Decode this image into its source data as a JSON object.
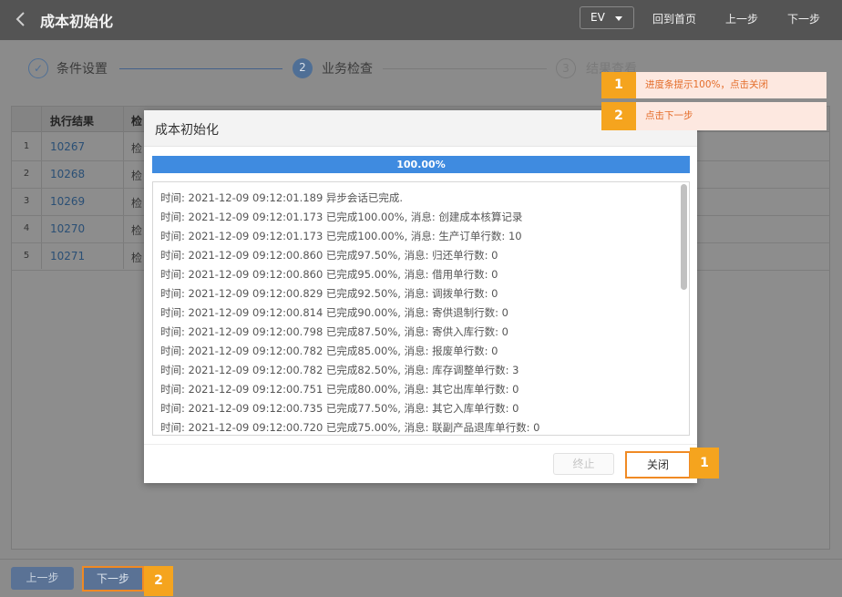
{
  "header": {
    "title": "成本初始化",
    "org_select": "EV",
    "nav": [
      "回到首页",
      "上一步",
      "下一步"
    ]
  },
  "steps": [
    {
      "label": "条件设置",
      "num": "✓",
      "state": "done"
    },
    {
      "label": "业务检查",
      "num": "2",
      "state": "active"
    },
    {
      "label": "结果查看",
      "num": "3",
      "state": "pending"
    }
  ],
  "grid": {
    "columns": [
      "执行结果",
      "检"
    ],
    "rows": [
      {
        "idx": "1",
        "id": "10267",
        "check": "检"
      },
      {
        "idx": "2",
        "id": "10268",
        "check": "检"
      },
      {
        "idx": "3",
        "id": "10269",
        "check": "检"
      },
      {
        "idx": "4",
        "id": "10270",
        "check": "检"
      },
      {
        "idx": "5",
        "id": "10271",
        "check": "检"
      }
    ]
  },
  "dialog": {
    "title": "成本初始化",
    "progress_text": "100.00%",
    "progress": 1.0,
    "log_lines": [
      "时间: 2021-12-09 09:12:01.189 异步会话已完成.",
      "时间: 2021-12-09 09:12:01.173 已完成100.00%, 消息: 创建成本核算记录",
      "时间: 2021-12-09 09:12:01.173 已完成100.00%, 消息: 生产订单行数: 10",
      "时间: 2021-12-09 09:12:00.860 已完成97.50%, 消息: 归还单行数: 0",
      "时间: 2021-12-09 09:12:00.860 已完成95.00%, 消息: 借用单行数: 0",
      "时间: 2021-12-09 09:12:00.829 已完成92.50%, 消息: 调拨单行数: 0",
      "时间: 2021-12-09 09:12:00.814 已完成90.00%, 消息: 寄供退制行数: 0",
      "时间: 2021-12-09 09:12:00.798 已完成87.50%, 消息: 寄供入库行数: 0",
      "时间: 2021-12-09 09:12:00.782 已完成85.00%, 消息: 报废单行数: 0",
      "时间: 2021-12-09 09:12:00.782 已完成82.50%, 消息: 库存调整单行数: 3",
      "时间: 2021-12-09 09:12:00.751 已完成80.00%, 消息: 其它出库单行数: 0",
      "时间: 2021-12-09 09:12:00.735 已完成77.50%, 消息: 其它入库单行数: 0",
      "时间: 2021-12-09 09:12:00.720 已完成75.00%, 消息: 联副产品退库单行数: 0"
    ],
    "stop_label": "终止",
    "close_label": "关闭"
  },
  "footer": {
    "prev_label": "上一步",
    "next_label": "下一步"
  },
  "annotations": [
    {
      "num": "1",
      "text": "进度条提示100%，点击关闭"
    },
    {
      "num": "2",
      "text": "点击下一步"
    }
  ],
  "colors": {
    "topbar": "#545454",
    "accent": "#3f8be0",
    "highlight": "#f08a24",
    "marker": "#f5a41e"
  }
}
